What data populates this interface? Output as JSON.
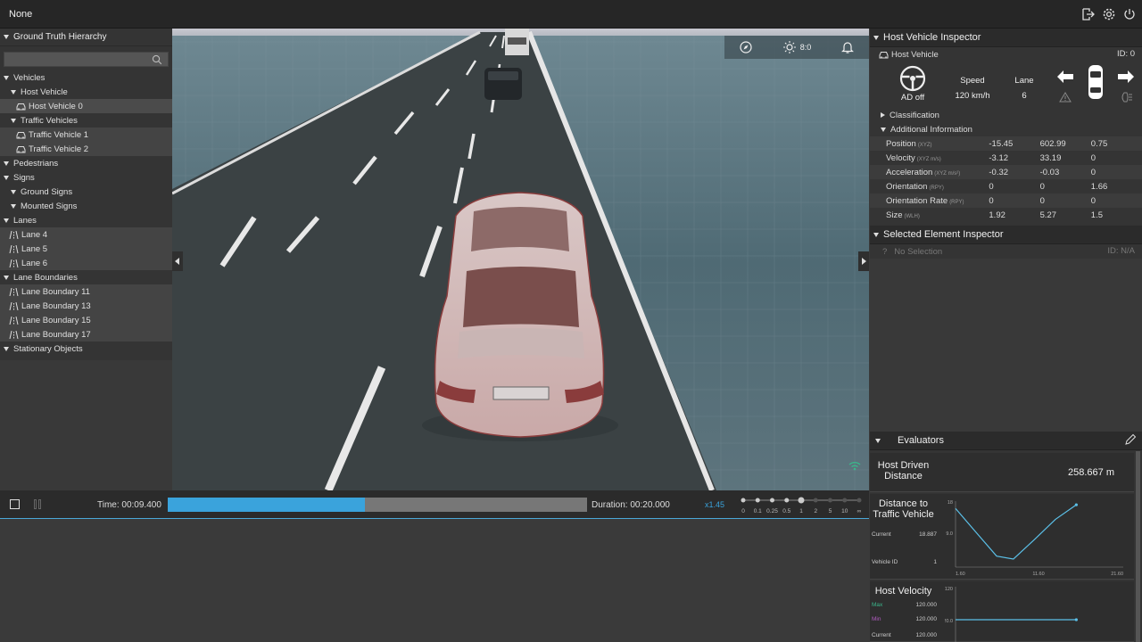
{
  "app": {
    "title": "None"
  },
  "left_panel": {
    "header": "Ground Truth Hierarchy",
    "search_placeholder": "",
    "tree": [
      {
        "label": "Vehicles",
        "level": 0,
        "kind": "group"
      },
      {
        "label": "Host Vehicle",
        "level": 1,
        "kind": "group"
      },
      {
        "label": "Host Vehicle 0",
        "level": 2,
        "kind": "car",
        "selected": true
      },
      {
        "label": "Traffic Vehicles",
        "level": 1,
        "kind": "group"
      },
      {
        "label": "Traffic Vehicle 1",
        "level": 2,
        "kind": "car"
      },
      {
        "label": "Traffic Vehicle 2",
        "level": 2,
        "kind": "car"
      },
      {
        "label": "Pedestrians",
        "level": 0,
        "kind": "group"
      },
      {
        "label": "Signs",
        "level": 0,
        "kind": "group"
      },
      {
        "label": "Ground Signs",
        "level": 1,
        "kind": "group"
      },
      {
        "label": "Mounted Signs",
        "level": 1,
        "kind": "group"
      },
      {
        "label": "Lanes",
        "level": 0,
        "kind": "group"
      },
      {
        "label": "Lane 4",
        "level": 1,
        "kind": "lane"
      },
      {
        "label": "Lane 5",
        "level": 1,
        "kind": "lane"
      },
      {
        "label": "Lane 6",
        "level": 1,
        "kind": "lane"
      },
      {
        "label": "Lane Boundaries",
        "level": 0,
        "kind": "group"
      },
      {
        "label": "Lane Boundary 11",
        "level": 1,
        "kind": "lane"
      },
      {
        "label": "Lane Boundary 13",
        "level": 1,
        "kind": "lane"
      },
      {
        "label": "Lane Boundary 15",
        "level": 1,
        "kind": "lane"
      },
      {
        "label": "Lane Boundary 17",
        "level": 1,
        "kind": "lane"
      },
      {
        "label": "Stationary Objects",
        "level": 0,
        "kind": "group"
      }
    ]
  },
  "viewport": {
    "toolbar": {
      "lighting_value": "8:0"
    }
  },
  "timeline": {
    "time_label": "Time: 00:09.400",
    "duration_label": "Duration: 00:20.000",
    "progress": 0.47,
    "speed_label": "x1.45",
    "speed_ticks": [
      "0",
      "0.1",
      "0.25",
      "0.5",
      "1",
      "2",
      "5",
      "10",
      "∞"
    ]
  },
  "host_inspector": {
    "header": "Host Vehicle Inspector",
    "vehicle_label": "Host Vehicle",
    "id_label": "ID: 0",
    "ad_label": "AD off",
    "speed_title": "Speed",
    "speed_value": "120 km/h",
    "lane_title": "Lane",
    "lane_value": "6",
    "classification": "Classification",
    "additional": "Additional Information",
    "rows": [
      {
        "label": "Position",
        "unit": "(XYZ)",
        "values": [
          "-15.45",
          "602.99",
          "0.75"
        ]
      },
      {
        "label": "Velocity",
        "unit": "(XYZ m/s)",
        "values": [
          "-3.12",
          "33.19",
          "0"
        ]
      },
      {
        "label": "Acceleration",
        "unit": "(XYZ m/s²)",
        "values": [
          "-0.32",
          "-0.03",
          "0"
        ]
      },
      {
        "label": "Orientation",
        "unit": "(RPY)",
        "values": [
          "0",
          "0",
          "1.66"
        ]
      },
      {
        "label": "Orientation Rate",
        "unit": "(RPY)",
        "values": [
          "0",
          "0",
          "0"
        ]
      },
      {
        "label": "Size",
        "unit": "(WLH)",
        "values": [
          "1.92",
          "5.27",
          "1.5"
        ]
      }
    ]
  },
  "selected_inspector": {
    "header": "Selected Element Inspector",
    "no_selection": "No Selection",
    "id_label": "ID: N/A"
  },
  "evaluators": {
    "header": "Evaluators",
    "distance": {
      "name": "Host Driven Distance",
      "value": "258.667 m"
    },
    "distance_to_traffic": {
      "name": "Distance to Traffic Vehicle",
      "current_label": "Current",
      "current_value": "18.887",
      "vid_label": "Vehicle ID",
      "vid_value": "1"
    },
    "velocity": {
      "name": "Host Velocity",
      "max_label": "Max",
      "max_value": "120.000",
      "min_label": "Min",
      "min_value": "120.000",
      "current_label": "Current",
      "current_value": "120.000"
    }
  },
  "chart_data": [
    {
      "type": "line",
      "title": "",
      "x": [
        1.6,
        4.0,
        6.5,
        8.5,
        11.0,
        13.5,
        16.0
      ],
      "series": [
        {
          "values": [
            16,
            9.6,
            3.0,
            2.2,
            7.5,
            13.0,
            17.0
          ]
        }
      ],
      "xticks": [
        "1.60",
        "11.60",
        "21.60"
      ],
      "yticks": [
        "18",
        "9.0"
      ],
      "xlim": [
        1.6,
        21.6
      ],
      "ylim": [
        0,
        18
      ]
    },
    {
      "type": "line",
      "title": "",
      "x": [
        1.6,
        16.0
      ],
      "series": [
        {
          "values": [
            120,
            120
          ]
        }
      ],
      "yticks": [
        "120",
        "120.0"
      ],
      "xlim": [
        1.6,
        21.6
      ],
      "ylim": [
        0,
        240
      ]
    }
  ],
  "colors": {
    "accent": "#3aa3dc",
    "chart_line": "#5bc0e8",
    "max_label": "#3bb58a",
    "min_label": "#b05cc0"
  }
}
